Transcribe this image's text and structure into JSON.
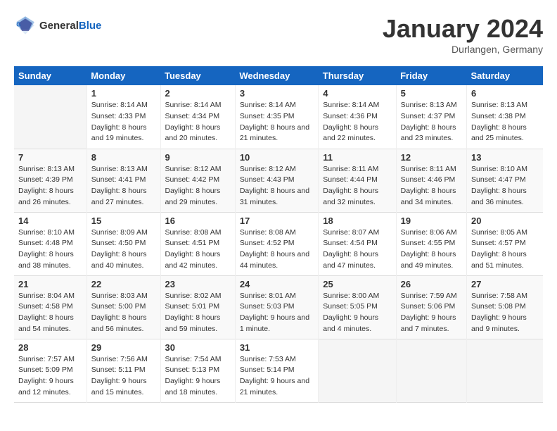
{
  "header": {
    "logo_general": "General",
    "logo_blue": "Blue",
    "month": "January 2024",
    "location": "Durlangen, Germany"
  },
  "weekdays": [
    "Sunday",
    "Monday",
    "Tuesday",
    "Wednesday",
    "Thursday",
    "Friday",
    "Saturday"
  ],
  "weeks": [
    [
      {
        "day": null
      },
      {
        "day": "1",
        "sunrise": "8:14 AM",
        "sunset": "4:33 PM",
        "daylight": "8 hours and 19 minutes."
      },
      {
        "day": "2",
        "sunrise": "8:14 AM",
        "sunset": "4:34 PM",
        "daylight": "8 hours and 20 minutes."
      },
      {
        "day": "3",
        "sunrise": "8:14 AM",
        "sunset": "4:35 PM",
        "daylight": "8 hours and 21 minutes."
      },
      {
        "day": "4",
        "sunrise": "8:14 AM",
        "sunset": "4:36 PM",
        "daylight": "8 hours and 22 minutes."
      },
      {
        "day": "5",
        "sunrise": "8:13 AM",
        "sunset": "4:37 PM",
        "daylight": "8 hours and 23 minutes."
      },
      {
        "day": "6",
        "sunrise": "8:13 AM",
        "sunset": "4:38 PM",
        "daylight": "8 hours and 25 minutes."
      }
    ],
    [
      {
        "day": "7",
        "sunrise": "8:13 AM",
        "sunset": "4:39 PM",
        "daylight": "8 hours and 26 minutes."
      },
      {
        "day": "8",
        "sunrise": "8:13 AM",
        "sunset": "4:41 PM",
        "daylight": "8 hours and 27 minutes."
      },
      {
        "day": "9",
        "sunrise": "8:12 AM",
        "sunset": "4:42 PM",
        "daylight": "8 hours and 29 minutes."
      },
      {
        "day": "10",
        "sunrise": "8:12 AM",
        "sunset": "4:43 PM",
        "daylight": "8 hours and 31 minutes."
      },
      {
        "day": "11",
        "sunrise": "8:11 AM",
        "sunset": "4:44 PM",
        "daylight": "8 hours and 32 minutes."
      },
      {
        "day": "12",
        "sunrise": "8:11 AM",
        "sunset": "4:46 PM",
        "daylight": "8 hours and 34 minutes."
      },
      {
        "day": "13",
        "sunrise": "8:10 AM",
        "sunset": "4:47 PM",
        "daylight": "8 hours and 36 minutes."
      }
    ],
    [
      {
        "day": "14",
        "sunrise": "8:10 AM",
        "sunset": "4:48 PM",
        "daylight": "8 hours and 38 minutes."
      },
      {
        "day": "15",
        "sunrise": "8:09 AM",
        "sunset": "4:50 PM",
        "daylight": "8 hours and 40 minutes."
      },
      {
        "day": "16",
        "sunrise": "8:08 AM",
        "sunset": "4:51 PM",
        "daylight": "8 hours and 42 minutes."
      },
      {
        "day": "17",
        "sunrise": "8:08 AM",
        "sunset": "4:52 PM",
        "daylight": "8 hours and 44 minutes."
      },
      {
        "day": "18",
        "sunrise": "8:07 AM",
        "sunset": "4:54 PM",
        "daylight": "8 hours and 47 minutes."
      },
      {
        "day": "19",
        "sunrise": "8:06 AM",
        "sunset": "4:55 PM",
        "daylight": "8 hours and 49 minutes."
      },
      {
        "day": "20",
        "sunrise": "8:05 AM",
        "sunset": "4:57 PM",
        "daylight": "8 hours and 51 minutes."
      }
    ],
    [
      {
        "day": "21",
        "sunrise": "8:04 AM",
        "sunset": "4:58 PM",
        "daylight": "8 hours and 54 minutes."
      },
      {
        "day": "22",
        "sunrise": "8:03 AM",
        "sunset": "5:00 PM",
        "daylight": "8 hours and 56 minutes."
      },
      {
        "day": "23",
        "sunrise": "8:02 AM",
        "sunset": "5:01 PM",
        "daylight": "8 hours and 59 minutes."
      },
      {
        "day": "24",
        "sunrise": "8:01 AM",
        "sunset": "5:03 PM",
        "daylight": "9 hours and 1 minute."
      },
      {
        "day": "25",
        "sunrise": "8:00 AM",
        "sunset": "5:05 PM",
        "daylight": "9 hours and 4 minutes."
      },
      {
        "day": "26",
        "sunrise": "7:59 AM",
        "sunset": "5:06 PM",
        "daylight": "9 hours and 7 minutes."
      },
      {
        "day": "27",
        "sunrise": "7:58 AM",
        "sunset": "5:08 PM",
        "daylight": "9 hours and 9 minutes."
      }
    ],
    [
      {
        "day": "28",
        "sunrise": "7:57 AM",
        "sunset": "5:09 PM",
        "daylight": "9 hours and 12 minutes."
      },
      {
        "day": "29",
        "sunrise": "7:56 AM",
        "sunset": "5:11 PM",
        "daylight": "9 hours and 15 minutes."
      },
      {
        "day": "30",
        "sunrise": "7:54 AM",
        "sunset": "5:13 PM",
        "daylight": "9 hours and 18 minutes."
      },
      {
        "day": "31",
        "sunrise": "7:53 AM",
        "sunset": "5:14 PM",
        "daylight": "9 hours and 21 minutes."
      },
      {
        "day": null
      },
      {
        "day": null
      },
      {
        "day": null
      }
    ]
  ]
}
